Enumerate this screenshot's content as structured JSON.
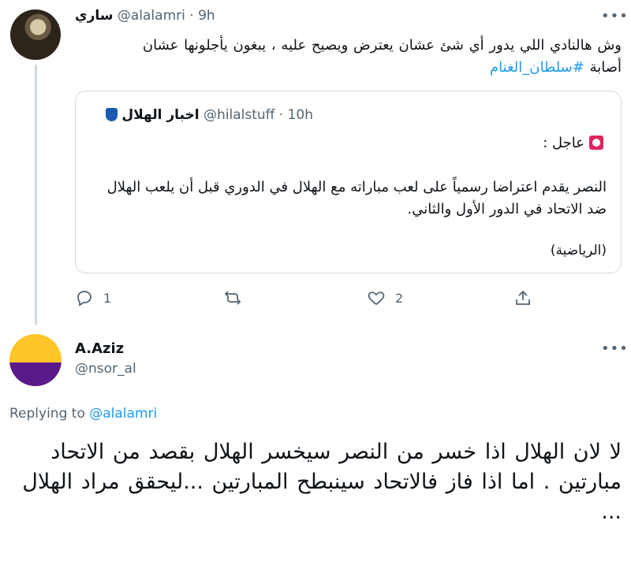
{
  "parent_tweet": {
    "display_name": "ساري",
    "handle": "@alalamri",
    "time": "9h",
    "more_icon": "more-horizontal-icon",
    "text_line1": "وش هالنادي اللي يدور أي شئ عشان يعترض ويصيح عليه ، يبغون يأجلونها عشان",
    "text_line2_prefix": "أصابة ",
    "text_hashtag": "#سلطان_الغنام",
    "quote": {
      "display_name": "اخبار الهلال",
      "handle": "@hilalstuff",
      "time": "10h",
      "badge_icon": "hilal-shield-icon",
      "urgent_icon": "siren-icon",
      "urgent_label": "عاجل :",
      "body": "النصر يقدم اعتراضا رسمياً على لعب مباراته مع الهلال في الدوري قبل أن يلعب الهلال ضد الاتحاد في الدور الأول والثاني.",
      "source": "(الرياضية)"
    },
    "actions": {
      "reply_count": "1",
      "retweet_count": "",
      "like_count": "2"
    }
  },
  "reply_tweet": {
    "display_name": "A.Aziz",
    "handle": "@nsor_al",
    "replying_label": "Replying to",
    "replying_to": "@alalamri",
    "text": "لا لان الهلال اذا خسر من النصر سيخسر الهلال بقصد من الاتحاد مبارتين . اما اذا فاز فالاتحاد  سينبطح المبارتين ...ليحقق  مراد الهلال ..."
  },
  "colors": {
    "accent": "#1d9bf0",
    "muted": "#536471",
    "border": "#cfd9de"
  }
}
